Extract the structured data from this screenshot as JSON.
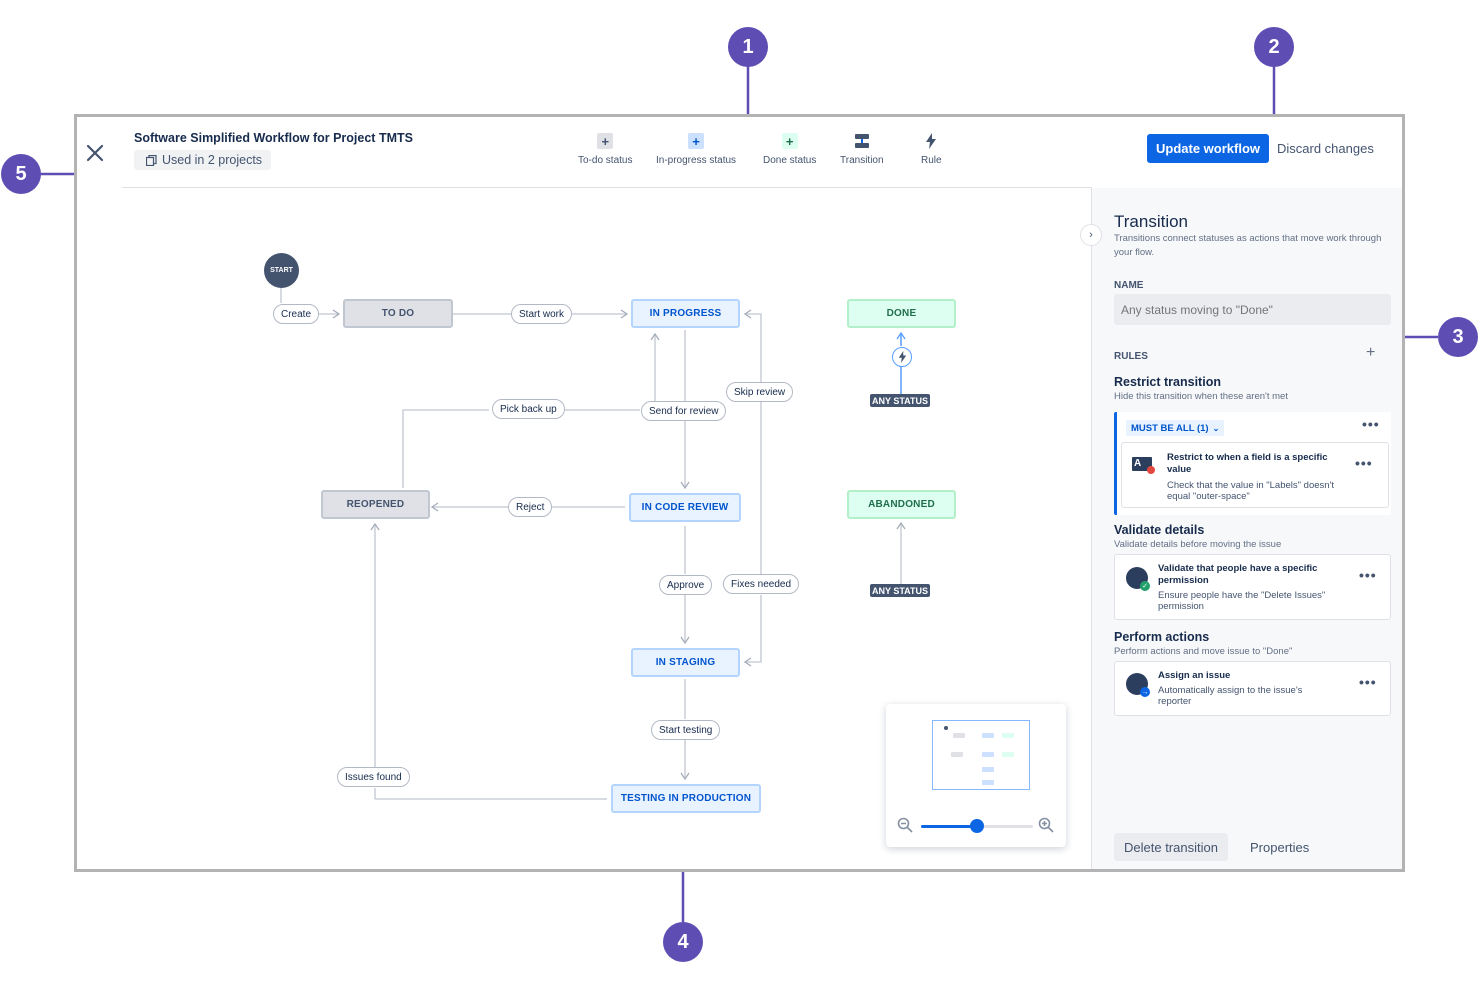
{
  "header": {
    "title": "Software Simplified Workflow for Project TMTS",
    "used_in": "Used in 2 projects",
    "tools": [
      {
        "label": "To-do status",
        "icon": "plus-icon",
        "color": "#dfe1e6"
      },
      {
        "label": "In-progress status",
        "icon": "plus-icon",
        "color": "#cce0ff"
      },
      {
        "label": "Done status",
        "icon": "plus-icon",
        "color": "#dcfff1"
      },
      {
        "label": "Transition",
        "icon": "transition-icon"
      },
      {
        "label": "Rule",
        "icon": "lightning-icon"
      }
    ],
    "update_button": "Update workflow",
    "discard_button": "Discard changes"
  },
  "canvas": {
    "start": "START",
    "statuses": {
      "todo": "TO DO",
      "in_progress": "IN PROGRESS",
      "done": "DONE",
      "reopened": "REOPENED",
      "in_code_review": "IN CODE REVIEW",
      "abandoned": "ABANDONED",
      "in_staging": "IN STAGING",
      "testing_in_production": "TESTING IN PRODUCTION"
    },
    "any_status": "ANY STATUS",
    "transitions": {
      "create": "Create",
      "start_work": "Start work",
      "skip_review": "Skip review",
      "pick_back_up": "Pick back up",
      "send_for_review": "Send for review",
      "reject": "Reject",
      "approve": "Approve",
      "fixes_needed": "Fixes needed",
      "start_testing": "Start testing",
      "issues_found": "Issues found"
    },
    "zoom_level": 0.5
  },
  "panel": {
    "title": "Transition",
    "description": "Transitions connect statuses as actions that move work through your flow.",
    "name_label": "NAME",
    "name_placeholder": "Any status moving to \"Done\"",
    "rules_label": "RULES",
    "restrict": {
      "title": "Restrict transition",
      "subtitle": "Hide this transition when these aren't met",
      "must_be_all": "MUST BE ALL (1)",
      "card_title": "Restrict to when a field is a specific value",
      "card_desc": "Check that the value in \"Labels\" doesn't equal \"outer-space\""
    },
    "validate": {
      "title": "Validate details",
      "subtitle": "Validate details before moving the issue",
      "card_title": "Validate that people have a specific permission",
      "card_desc": "Ensure people have the \"Delete Issues\" permission"
    },
    "perform": {
      "title": "Perform actions",
      "subtitle": "Perform actions and move issue to \"Done\"",
      "card_title": "Assign an issue",
      "card_desc": "Automatically assign to the issue's reporter"
    },
    "delete_button": "Delete transition",
    "properties_button": "Properties"
  },
  "callouts": [
    "1",
    "2",
    "3",
    "4",
    "5"
  ],
  "colors": {
    "accent": "#0c66e4",
    "callout": "#5e4db2"
  }
}
